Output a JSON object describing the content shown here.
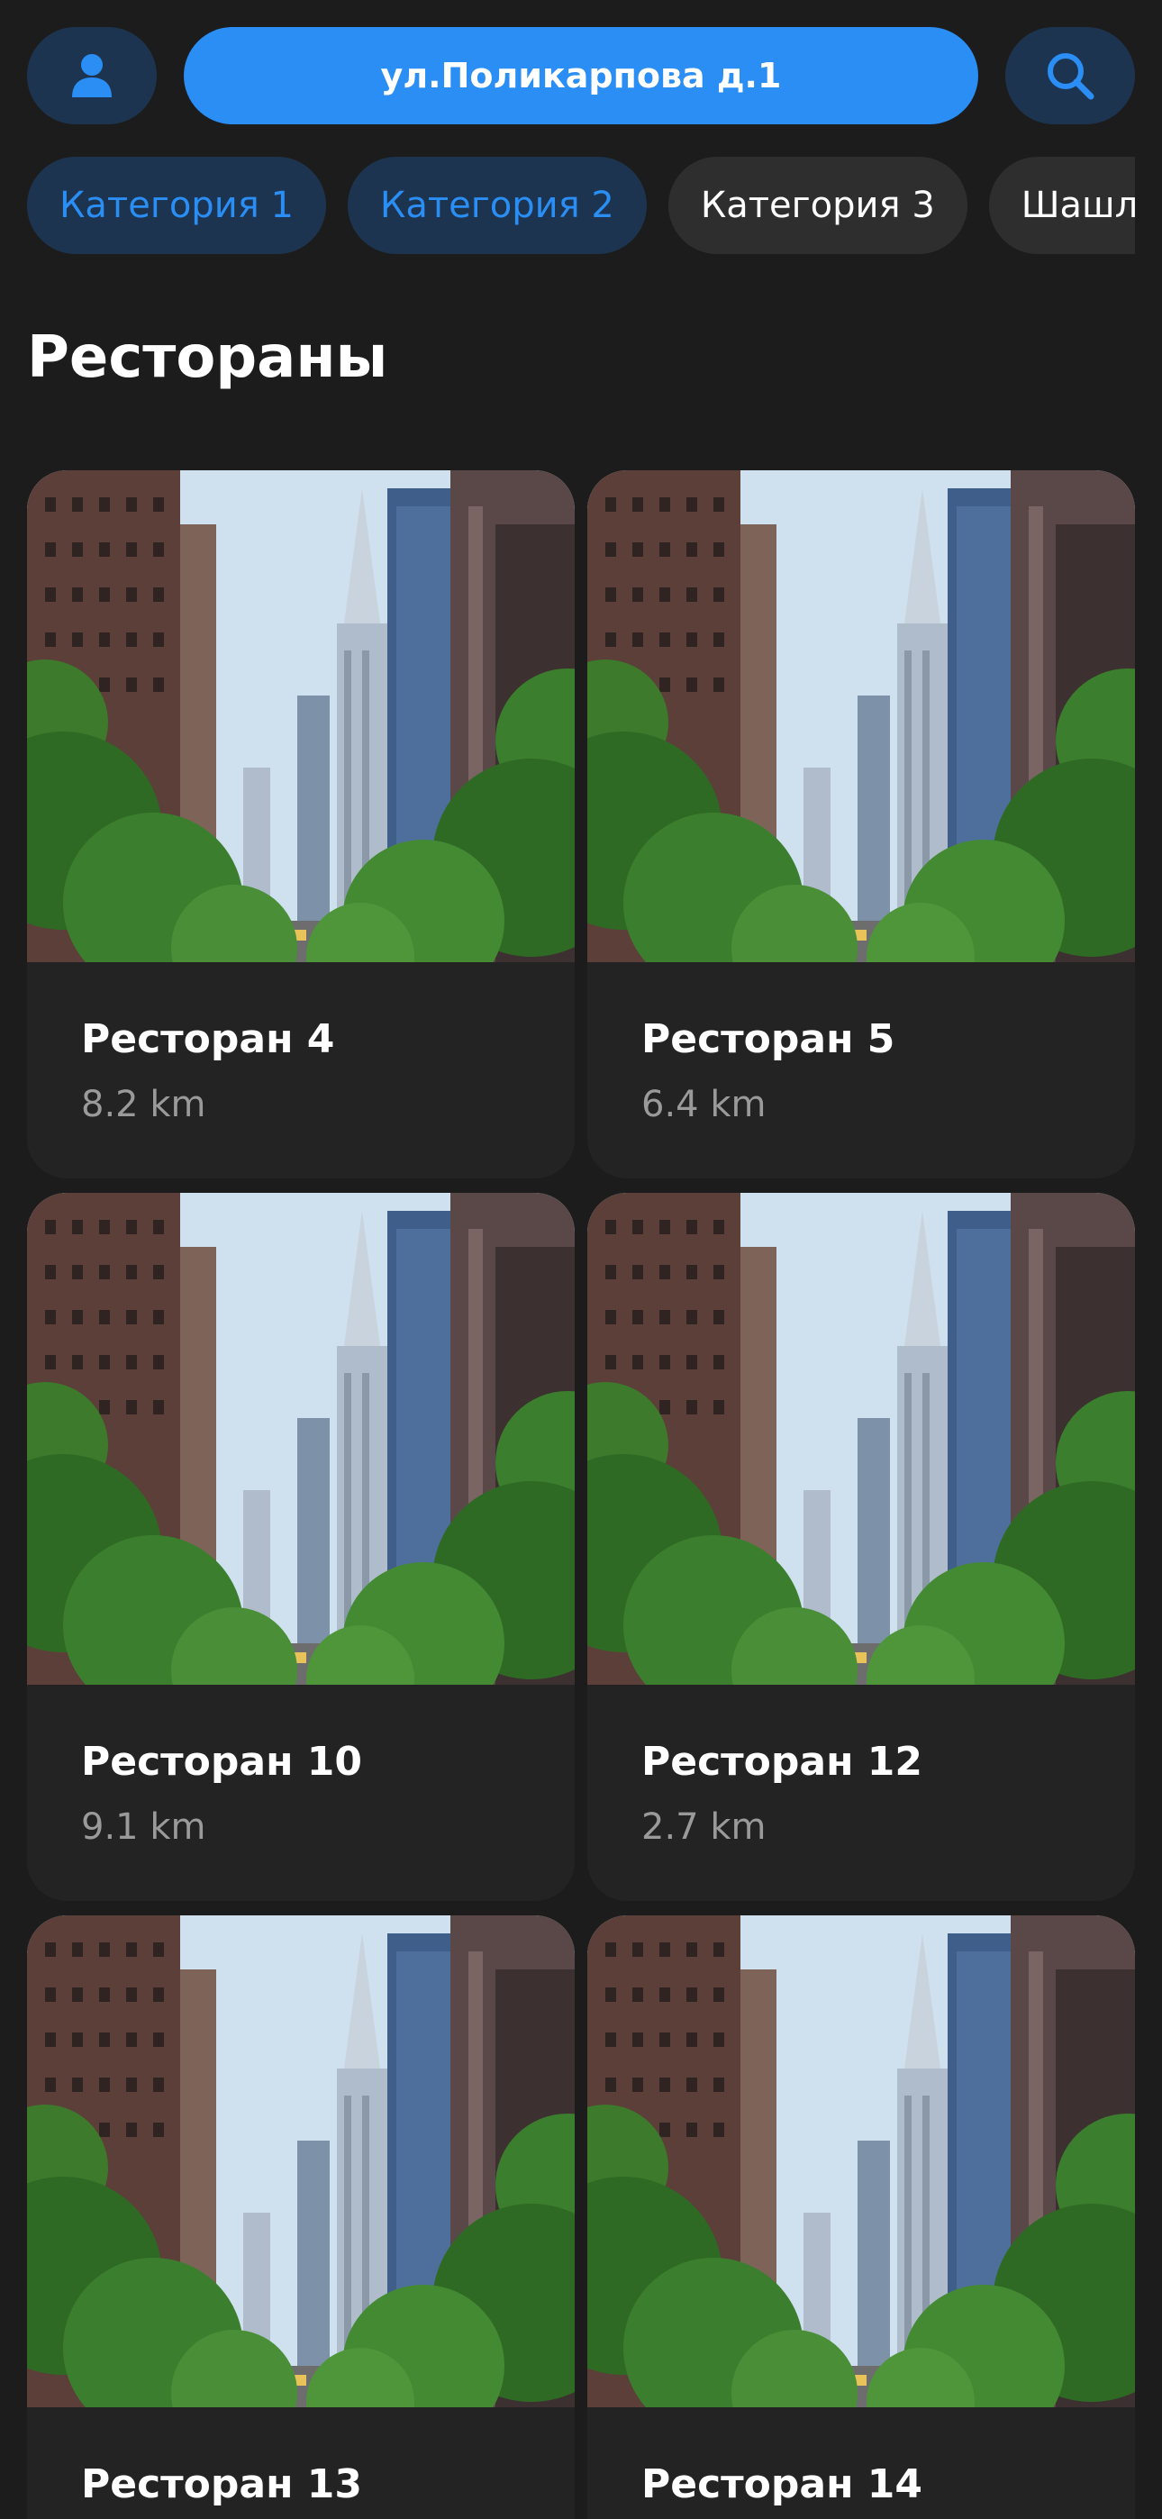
{
  "header": {
    "profile_icon": "person-icon",
    "address": "ул.Поликарпова д.1",
    "search_icon": "search-icon"
  },
  "categories": [
    {
      "label": "Категория 1",
      "active": true
    },
    {
      "label": "Категория 2",
      "active": true
    },
    {
      "label": "Категория 3",
      "active": false
    },
    {
      "label": "Шашлы",
      "active": false
    }
  ],
  "section": {
    "title": "Рестораны"
  },
  "restaurants": [
    {
      "name": "Ресторан 4",
      "distance": "8.2 km"
    },
    {
      "name": "Ресторан 5",
      "distance": "6.4 km"
    },
    {
      "name": "Ресторан 10",
      "distance": "9.1 km"
    },
    {
      "name": "Ресторан 12",
      "distance": "2.7 km"
    },
    {
      "name": "Ресторан 13",
      "distance": ""
    },
    {
      "name": "Ресторан 14",
      "distance": ""
    }
  ],
  "colors": {
    "background": "#1c1c1c",
    "accent": "#2a8ef5",
    "accent_dark": "#1d3450",
    "chip_inactive": "#2e2e2e",
    "card": "#232323",
    "muted_text": "#9a9a9a"
  }
}
